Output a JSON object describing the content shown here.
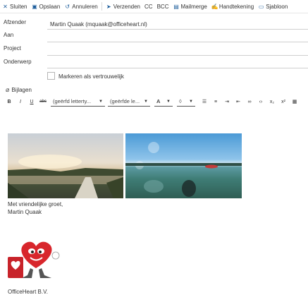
{
  "toolbar": {
    "close": "Sluiten",
    "save": "Opslaan",
    "cancel": "Annuleren",
    "send": "Verzenden",
    "cc": "CC",
    "bcc": "BCC",
    "mailmerge": "Mailmerge",
    "signature": "Handtekening",
    "template": "Sjabloon"
  },
  "fields": {
    "from_label": "Afzender",
    "from_value": "Martin Quaak (mquaak@officeheart.nl)",
    "to_label": "Aan",
    "project_label": "Project",
    "subject_label": "Onderwerp"
  },
  "confidential_label": "Markeren als vertrouwelijk",
  "attachments_label": "Bijlagen",
  "format": {
    "bold": "B",
    "italic": "I",
    "underline": "U",
    "strike": "abc",
    "font_family": "(geërfd letterty...",
    "font_size": "(geërfde le...",
    "font_color": "A",
    "highlight": "◊",
    "subscript": "x₂",
    "superscript": "x²"
  },
  "body": {
    "closing": "Met vriendelijke groet,",
    "name": "Martin Quaak",
    "company": "OfficeHeart B.V."
  },
  "colors": {
    "accent": "#1d5d9b",
    "logo_red": "#d8262c"
  }
}
